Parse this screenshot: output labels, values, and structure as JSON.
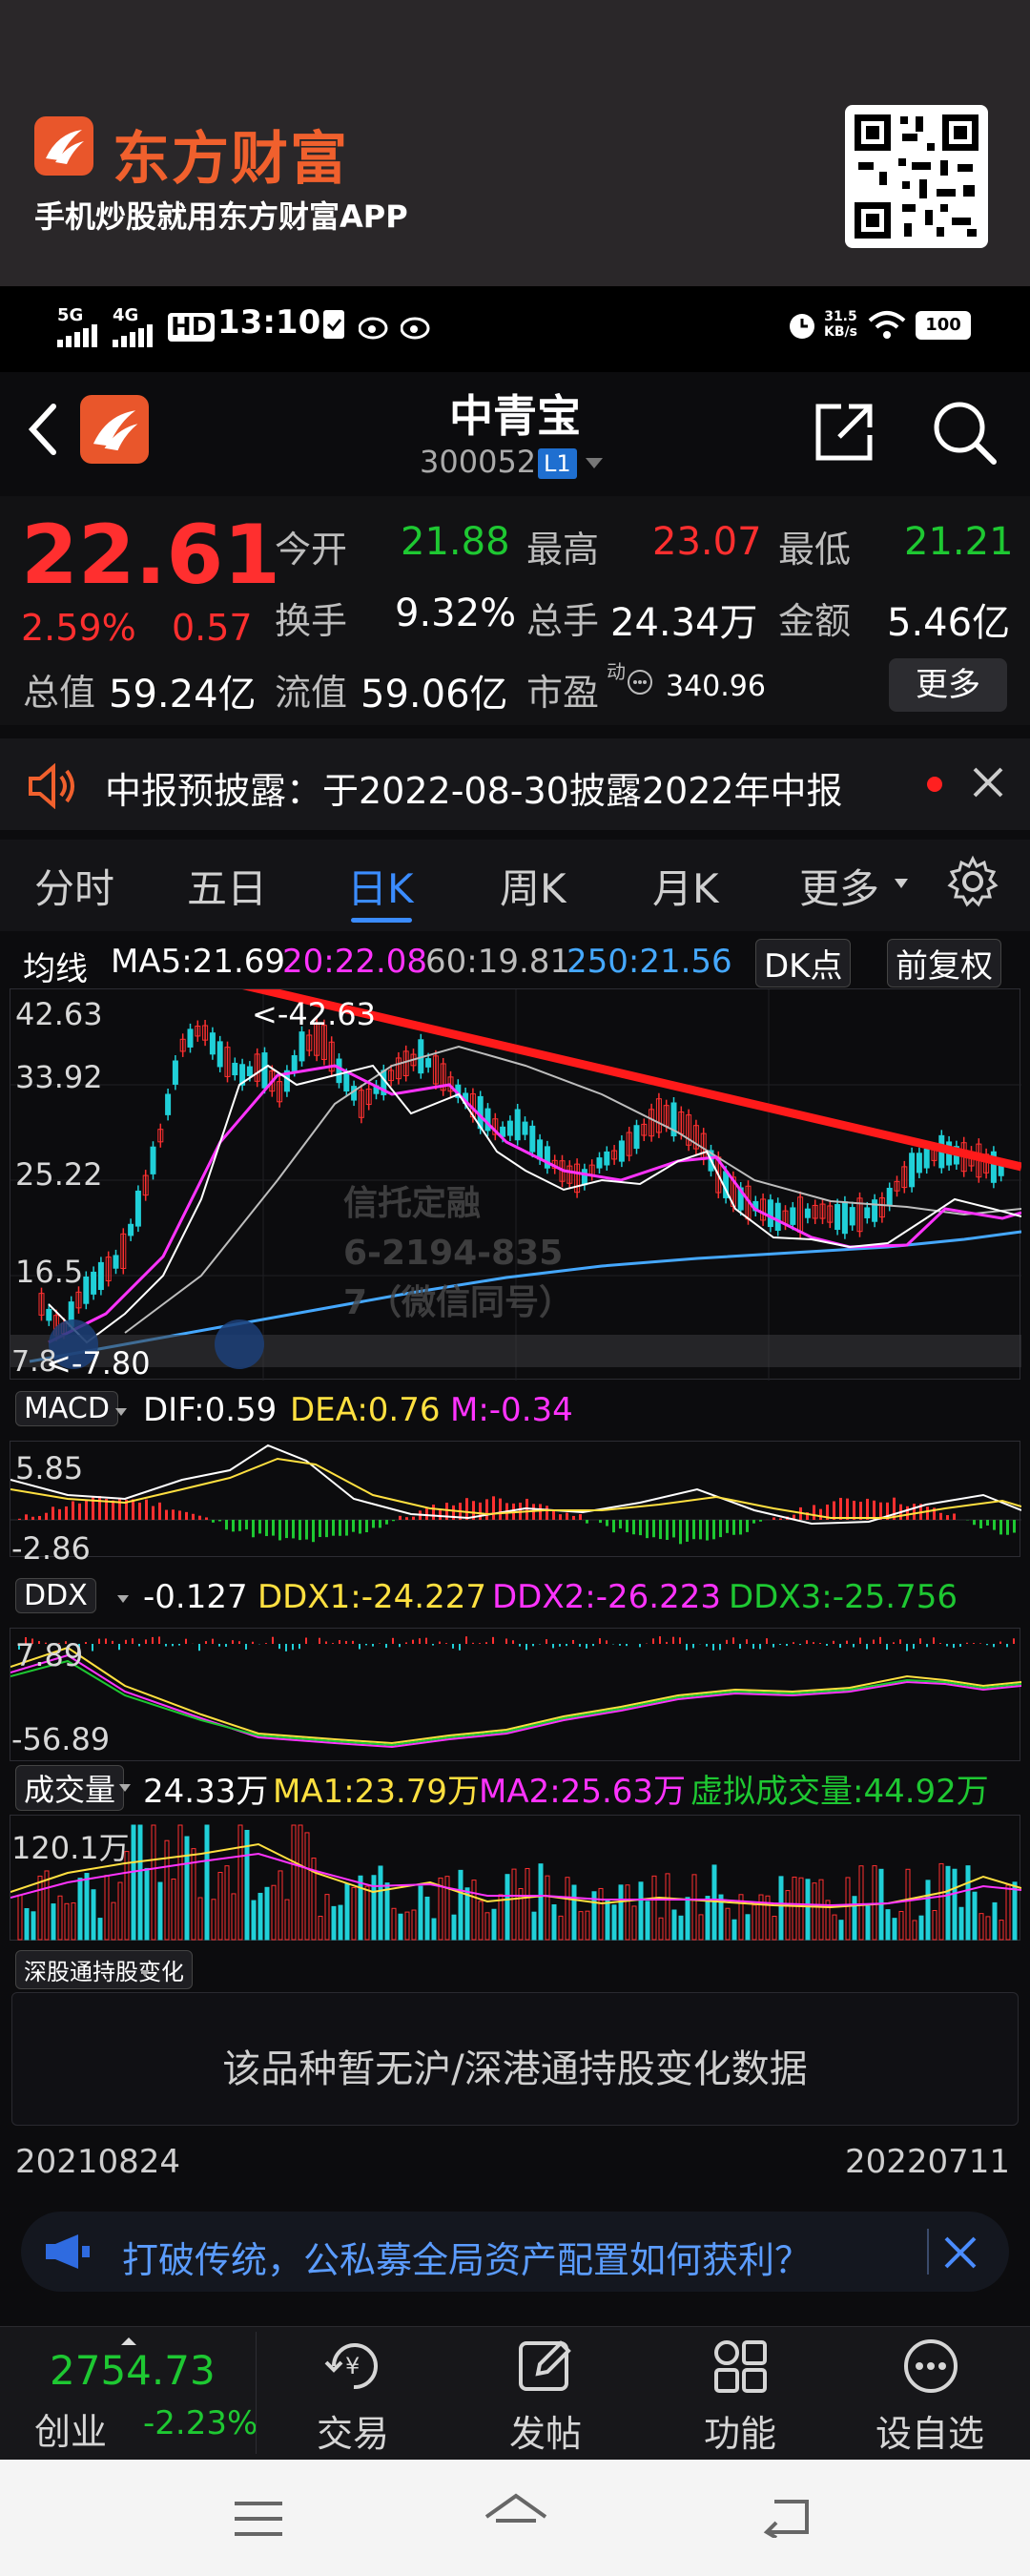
{
  "banner": {
    "brand_name": "东方财富",
    "slogan": "手机炒股就用东方财富APP",
    "brand_color": "#f0602d"
  },
  "status_bar": {
    "network_1": "5G",
    "network_2": "4G",
    "hd": "HD",
    "time": "13:10",
    "speed_value": "31.5",
    "speed_unit": "KB/s",
    "battery": "100"
  },
  "header": {
    "stock_name": "中青宝",
    "stock_code": "300052",
    "level_badge": "L1"
  },
  "quote": {
    "price": "22.61",
    "change_pct": "2.59%",
    "change_abs": "0.57",
    "open_label": "今开",
    "open_value": "21.88",
    "high_label": "最高",
    "high_value": "23.07",
    "low_label": "最低",
    "low_value": "21.21",
    "turnover_label": "换手",
    "turnover_value": "9.32%",
    "volume_label": "总手",
    "volume_value": "24.34万",
    "amount_label": "金额",
    "amount_value": "5.46亿",
    "mktcap_label": "总值",
    "mktcap_value": "59.24亿",
    "float_label": "流值",
    "float_value": "59.06亿",
    "pe_label": "市盈",
    "pe_sup": "动",
    "pe_value": "340.96",
    "more_label": "更多"
  },
  "notice": {
    "text": "中报预披露：于2022-08-30披露2022年中报"
  },
  "tabs": [
    {
      "label": "分时"
    },
    {
      "label": "五日"
    },
    {
      "label": "日K"
    },
    {
      "label": "周K"
    },
    {
      "label": "月K"
    },
    {
      "label": "更多"
    }
  ],
  "kline": {
    "indicator_label": "均线",
    "ma5": "MA5:21.69",
    "ma20": "20:22.08",
    "ma60": "60:19.81",
    "ma250": "250:21.56",
    "dk_button": "DK点",
    "adjust_button": "前复权",
    "y_labels": [
      "42.63",
      "33.92",
      "25.22",
      "16.5"
    ],
    "max_marker": "<-42.63",
    "min_marker": "<-7.80",
    "min_axis": "7.8",
    "watermark": [
      "信托定融",
      "6-2194-835",
      "7（微信同号）"
    ],
    "colors": {
      "ma5": "#ffffff",
      "ma20": "#ff33ff",
      "ma60": "#bdbdbd",
      "ma250": "#45a8ff",
      "trend": "#ff1a1a"
    }
  },
  "macd": {
    "label": "MACD",
    "dif": "DIF:0.59",
    "dea": "DEA:0.76",
    "m": "M:-0.34",
    "y_top": "5.85",
    "y_bottom": "-2.86"
  },
  "ddx": {
    "label": "DDX",
    "value": "-0.127",
    "ddx1": "DDX1:-24.227",
    "ddx2": "DDX2:-26.223",
    "ddx3": "DDX3:-25.756",
    "y_top": "7.89",
    "y_bottom": "-56.89"
  },
  "volume": {
    "label": "成交量",
    "value": "24.33万",
    "ma1": "MA1:23.79万",
    "ma2": "MA2:25.63万",
    "virtual": "虚拟成交量:44.92万",
    "y_top": "120.1万"
  },
  "hk_flow": {
    "chip_label": "深股通持股变化",
    "no_data": "该品种暂无沪/深港通持股变化数据"
  },
  "dates": {
    "start": "20210824",
    "end": "20220711"
  },
  "ad": {
    "text": "打破传统，公私募全局资产配置如何获利？"
  },
  "bottom_nav": {
    "index_value": "2754.73",
    "index_name": "创业",
    "index_change": "-2.23%",
    "trade": "交易",
    "post": "发帖",
    "function": "功能",
    "settings": "设自选"
  }
}
